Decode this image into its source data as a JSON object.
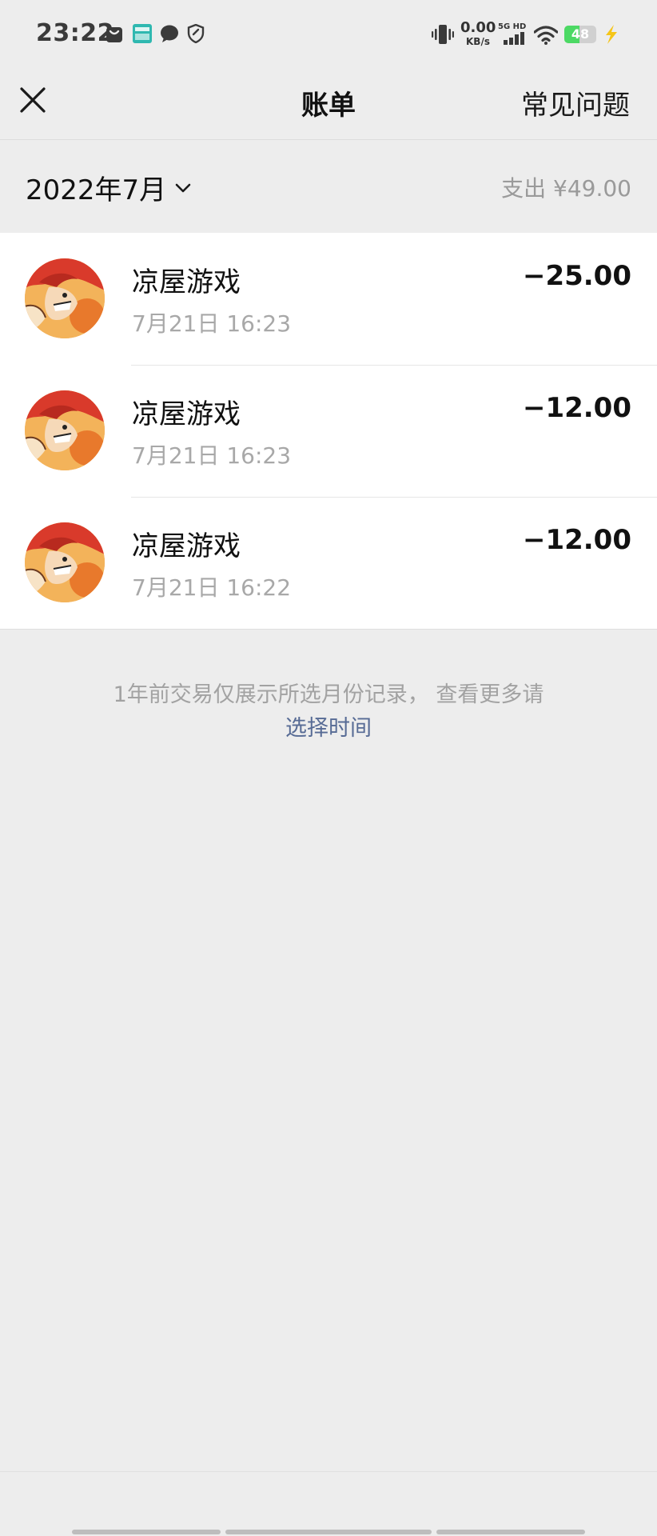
{
  "status_bar": {
    "time": "23:22",
    "net_speed_value": "0.00",
    "net_speed_unit": "KB/s",
    "network_badge": "5G HD",
    "battery_level": "48",
    "battery_percent": 48,
    "icons": [
      "bag-icon",
      "boss-app-icon",
      "chat-bubble-icon",
      "shield-icon",
      "vibrate-icon",
      "signal-icon",
      "wifi-icon",
      "battery-icon",
      "charging-icon"
    ]
  },
  "nav": {
    "close_icon": "close-icon",
    "title": "账单",
    "faq_label": "常见问题"
  },
  "month_header": {
    "month_label": "2022年7月",
    "chevron_icon": "chevron-down-icon",
    "total_label": "支出 ¥49.00"
  },
  "transactions": [
    {
      "name": "凉屋游戏",
      "time": "7月21日 16:23",
      "amount": "−25.00"
    },
    {
      "name": "凉屋游戏",
      "time": "7月21日 16:23",
      "amount": "−12.00"
    },
    {
      "name": "凉屋游戏",
      "time": "7月21日 16:22",
      "amount": "−12.00"
    }
  ],
  "footer_note": {
    "text": "1年前交易仅展示所选月份记录， 查看更多请",
    "link_label": "选择时间"
  },
  "colors": {
    "background": "#ededed",
    "list_background": "#ffffff",
    "link": "#576b95",
    "secondary_text": "#a8a8a8",
    "battery_green": "#4cd964"
  }
}
